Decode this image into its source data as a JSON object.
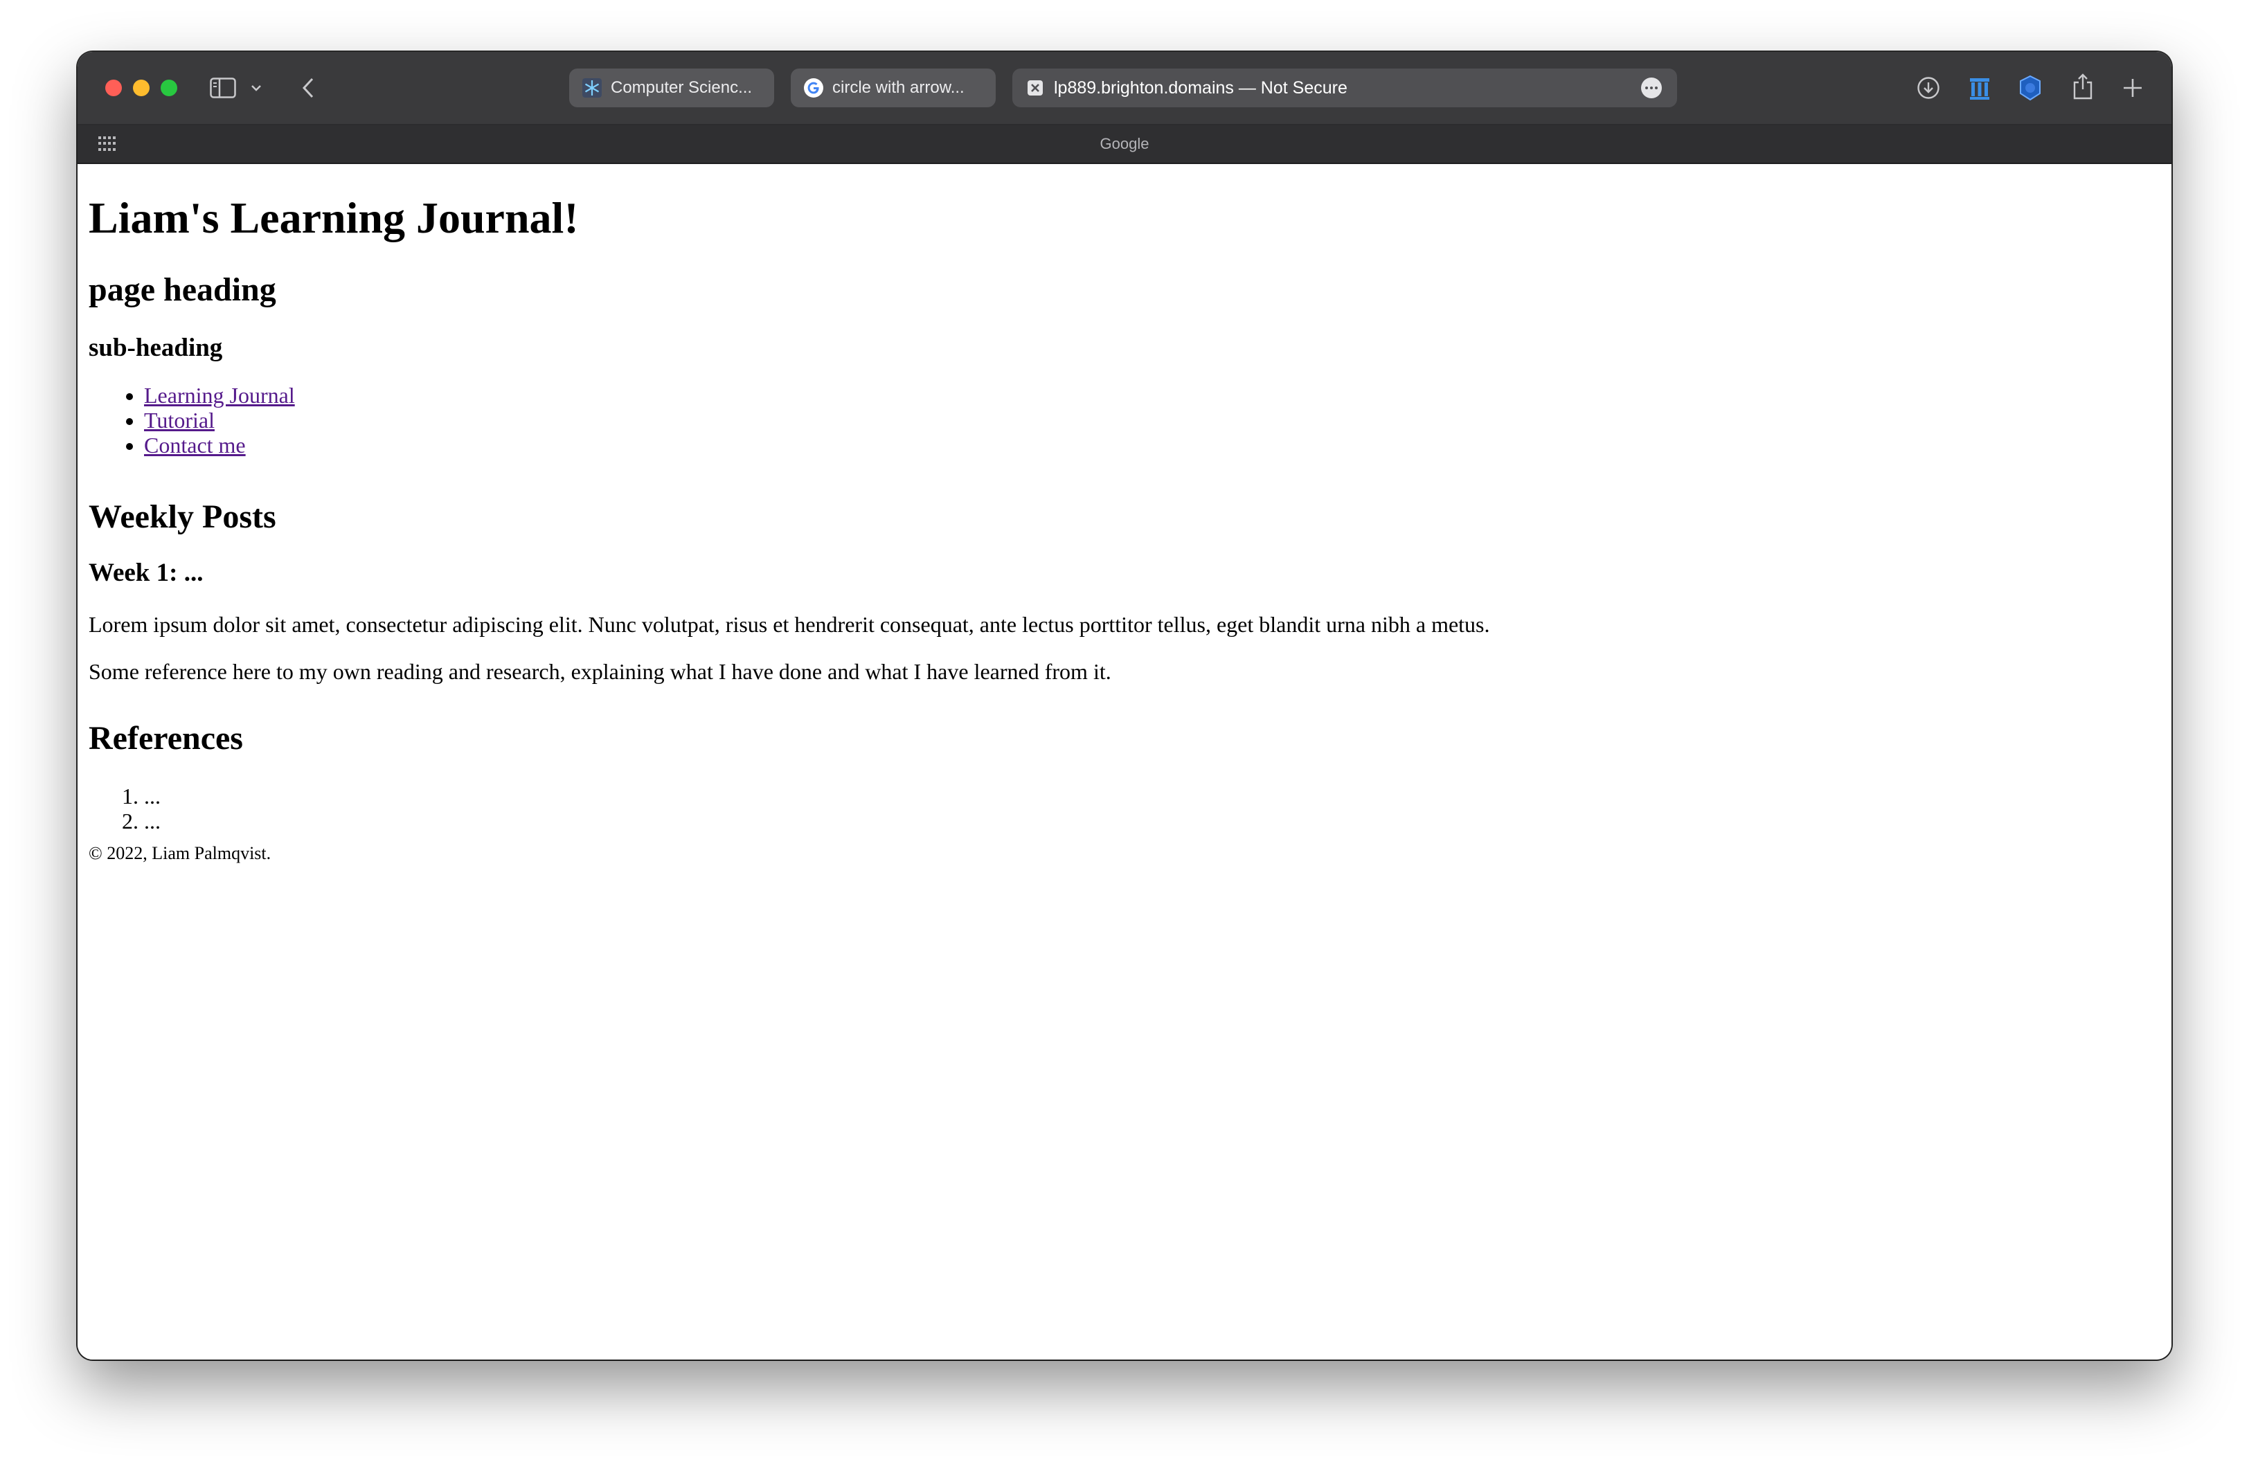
{
  "browser": {
    "tabs": [
      {
        "label": "Computer Scienc...",
        "icon": "snowflake-icon"
      },
      {
        "label": "circle with arrow...",
        "icon": "google-g-icon"
      }
    ],
    "active_tab": {
      "label": "lp889.brighton.domains — Not Secure",
      "icon": "close-square-icon"
    },
    "favorites_bar": {
      "label": "Google"
    },
    "colors": {
      "toolbar": "#3a3a3c",
      "tab": "#57575a",
      "link_visited": "#551a8b"
    }
  },
  "page": {
    "title": "Liam's Learning Journal!",
    "page_heading": "page heading",
    "sub_heading": "sub-heading",
    "nav": [
      {
        "label": "Learning Journal"
      },
      {
        "label": "Tutorial"
      },
      {
        "label": "Contact me"
      }
    ],
    "weekly_heading": "Weekly Posts",
    "week_heading": "Week 1: ...",
    "paragraphs": [
      "Lorem ipsum dolor sit amet, consectetur adipiscing elit. Nunc volutpat, risus et hendrerit consequat, ante lectus porttitor tellus, eget blandit urna nibh a metus.",
      "Some reference here to my own reading and research, explaining what I have done and what I have learned from it."
    ],
    "references_heading": "References",
    "references": [
      "...",
      "..."
    ],
    "footer": "© 2022, Liam Palmqvist."
  }
}
